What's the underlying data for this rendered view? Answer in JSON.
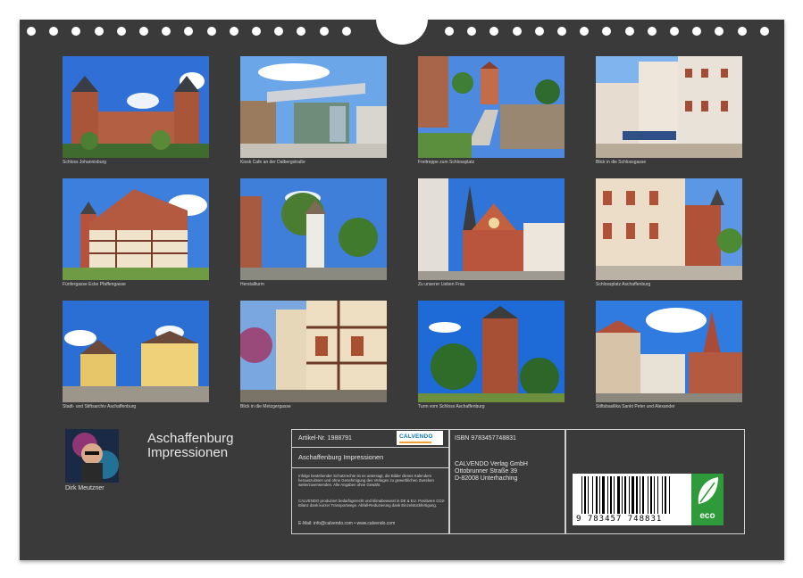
{
  "calendar": {
    "title_line1": "Aschaffenburg",
    "title_line2": "Impressionen",
    "author": "Dirk Meutzner"
  },
  "photos": [
    {
      "caption": "Schloss Johannisburg"
    },
    {
      "caption": "Kiosk Cafe an der Dalbergstraße"
    },
    {
      "caption": "Freitreppe zum Schlossplatz"
    },
    {
      "caption": "Blick in die Schlossgasse"
    },
    {
      "caption": "Fünfergasse Ecke Pfaffengasse"
    },
    {
      "caption": "Herstallturm"
    },
    {
      "caption": "Zu unserer Lieben Frau"
    },
    {
      "caption": "Schlossplatz Aschaffenburg"
    },
    {
      "caption": "Stadt- und Stiftsarchiv Aschaffenburg"
    },
    {
      "caption": "Blick in die Metzgergasse"
    },
    {
      "caption": "Turm vom Schloss Aschaffenburg"
    },
    {
      "caption": "Stiftsbasilika Sankt Peter und Alexander"
    }
  ],
  "info": {
    "article": "Artikel-Nr. 1988791",
    "logo_text": "CALVENDO",
    "product_title": "Aschaffenburg Impressionen",
    "legal": "Infolge bestehender Schutzrechte ist es untersagt, die Bilder dieses Kalenders herauszulösen und ohne Genehmigung des Verlages zu gewerblichen Zwecken weiterzuverwenden. Alle Angaben ohne Gewähr.",
    "eco_note": "CALVENDO produziert bedarfsgerecht und klimabewusst in DE & EU. Positivere CO2-Bilanz dank kurzer Transportwege. Abfall-Reduzierung dank Einzelstückfertigung.",
    "contact": "E-Mail: info@calvendo.com • www.calvendo.com",
    "isbn": "ISBN 9783457748831",
    "publisher_line1": "CALVENDO Verlag GmbH",
    "publisher_line2": "Ottobrunner Straße 39",
    "publisher_line3": "D-82008 Unterhaching",
    "barcode_digits": "9 783457 748831",
    "eco_label": "eco"
  },
  "colors": {
    "sheet": "#3a3a3a",
    "eco_green": "#2f9a3a"
  }
}
